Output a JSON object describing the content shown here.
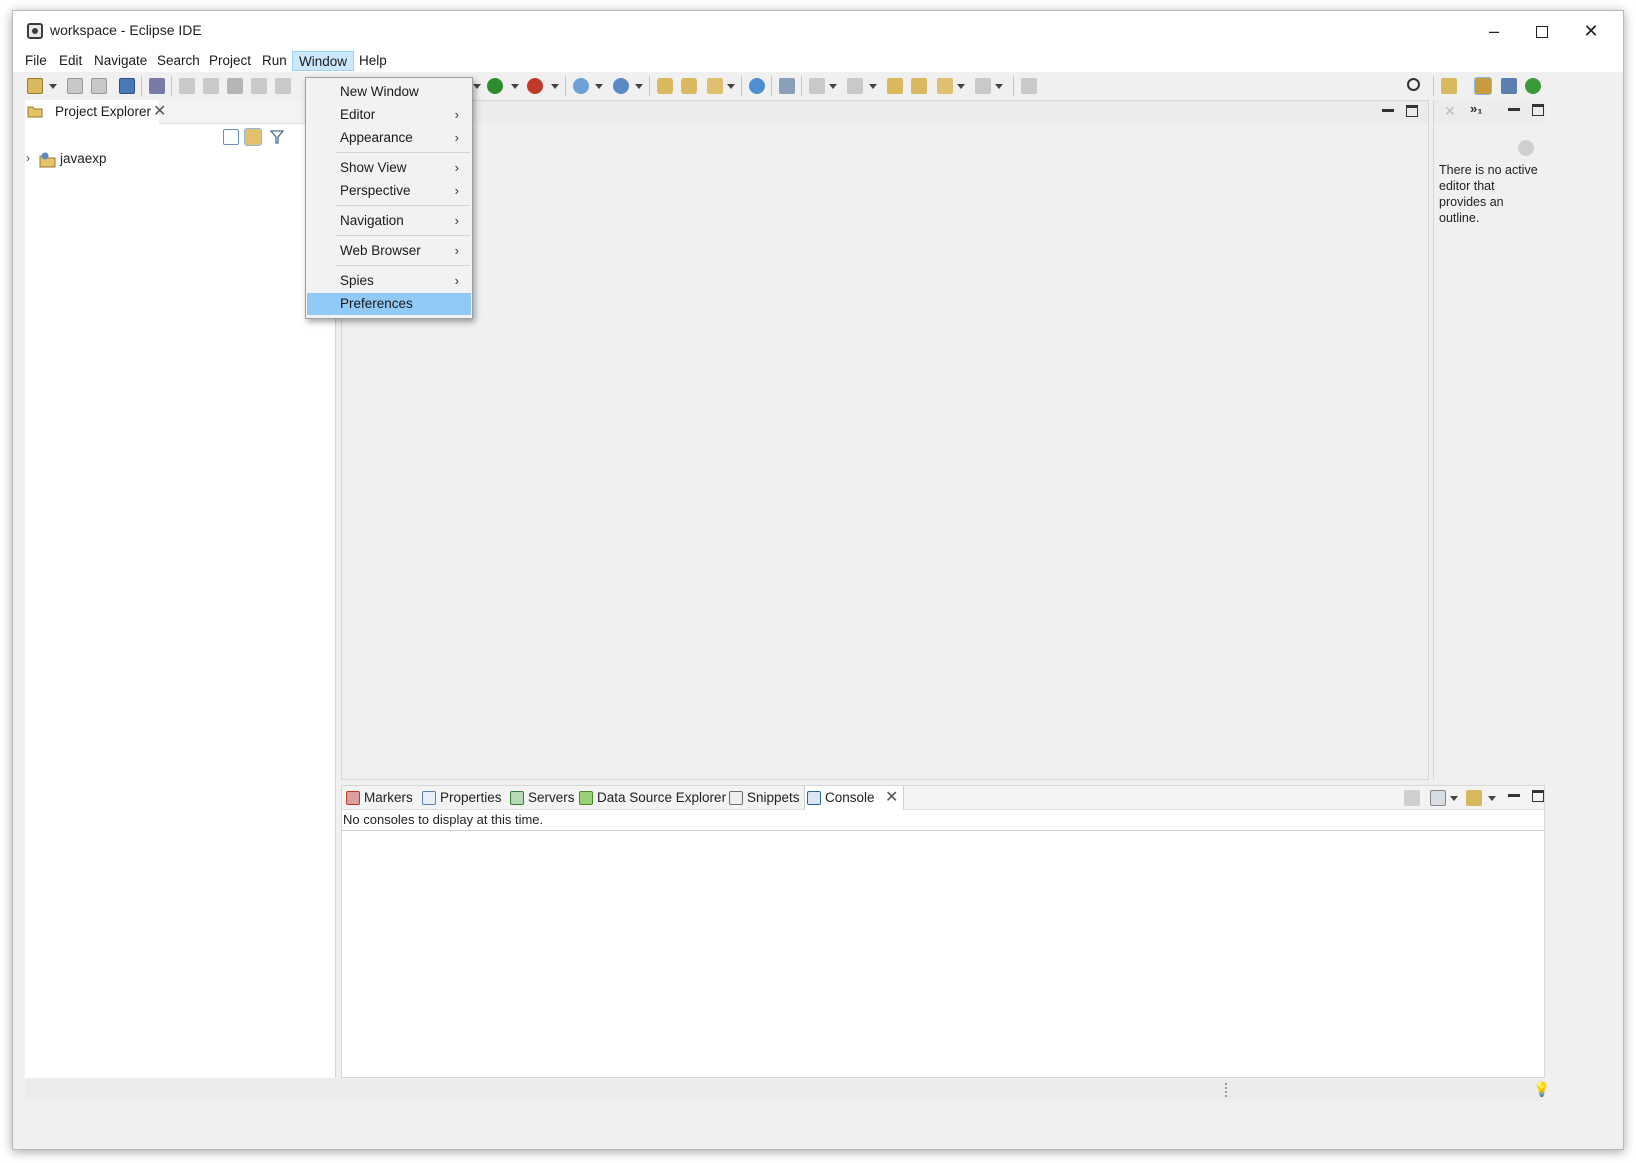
{
  "window": {
    "title": "workspace - Eclipse IDE",
    "controls": {
      "minimize": "–",
      "maximize": "□",
      "close": "✕"
    }
  },
  "menubar": {
    "items": [
      "File",
      "Edit",
      "Navigate",
      "Search",
      "Project",
      "Run",
      "Window",
      "Help"
    ],
    "active": "Window"
  },
  "window_menu": {
    "items": [
      {
        "label": "New Window",
        "submenu": false
      },
      {
        "label": "Editor",
        "submenu": true
      },
      {
        "label": "Appearance",
        "submenu": true
      },
      {
        "label": "Show View",
        "submenu": true
      },
      {
        "label": "Perspective",
        "submenu": true
      },
      {
        "label": "Navigation",
        "submenu": true
      },
      {
        "label": "Web Browser",
        "submenu": true
      },
      {
        "label": "Spies",
        "submenu": true
      },
      {
        "label": "Preferences",
        "submenu": false,
        "highlighted": true
      }
    ],
    "arrow_glyph": "›"
  },
  "project_explorer": {
    "tab_label": "Project Explorer",
    "close_glyph": "✕",
    "tree": [
      {
        "label": "javaexp",
        "expanded": false,
        "chevron": "›"
      }
    ]
  },
  "outline": {
    "message": "There is no active editor that provides an outline.",
    "close_glyph": "✕",
    "overflow_glyph": "»₁"
  },
  "bottom_panel": {
    "tabs": [
      {
        "label": "Markers",
        "icon": "markers-icon",
        "color": "#c0392b"
      },
      {
        "label": "Properties",
        "icon": "properties-icon",
        "color": "#5b7fa6"
      },
      {
        "label": "Servers",
        "icon": "servers-icon",
        "color": "#3a7d3a"
      },
      {
        "label": "Data Source Explorer",
        "icon": "data-source-icon",
        "color": "#4a8a2a"
      },
      {
        "label": "Snippets",
        "icon": "snippets-icon",
        "color": "#6d6d6d"
      },
      {
        "label": "Console",
        "icon": "console-icon",
        "color": "#2f5f9e",
        "active": true
      }
    ],
    "console_message": "No consoles to display at this time.",
    "close_glyph": "✕"
  },
  "status": {
    "bulb_glyph": "💡"
  },
  "colors": {
    "menu_highlight": "#91c9f7",
    "menubar_active": "#cce8ff",
    "chrome": "#f0f0f0"
  }
}
